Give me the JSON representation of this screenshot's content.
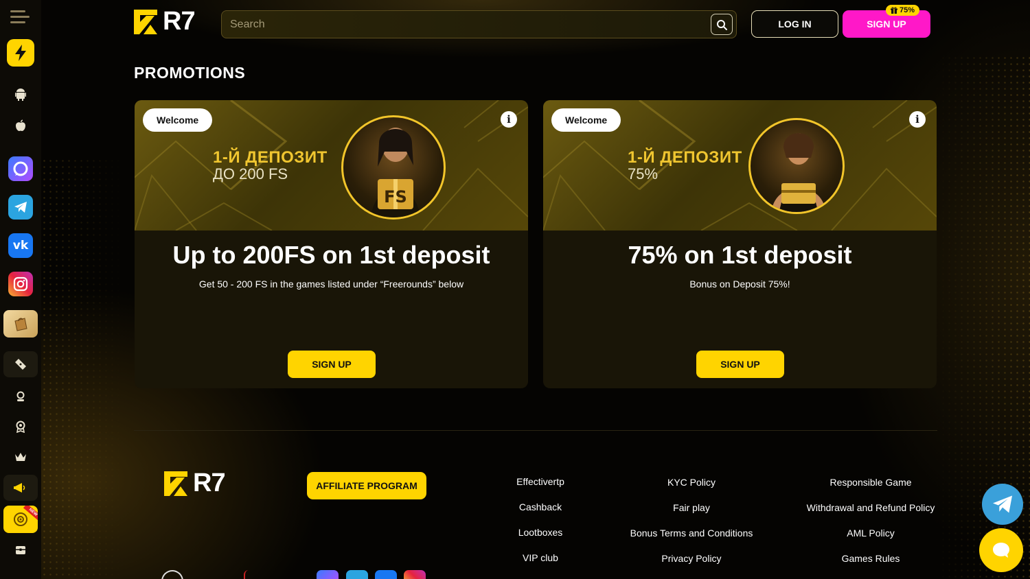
{
  "header": {
    "logo_text": "R7",
    "search_placeholder": "Search",
    "login_label": "LOG IN",
    "signup_label": "SIGN UP",
    "signup_badge": "75%"
  },
  "sidebar": {
    "items": [
      {
        "name": "menu-icon"
      },
      {
        "name": "lightning-icon",
        "glyph": "⚡"
      },
      {
        "name": "android-icon"
      },
      {
        "name": "apple-icon",
        "glyph": ""
      },
      {
        "name": "chat-app-icon"
      },
      {
        "name": "telegram-icon"
      },
      {
        "name": "vk-icon",
        "glyph": "vk"
      },
      {
        "name": "instagram-icon"
      },
      {
        "name": "shopping-bag-icon"
      },
      {
        "name": "ticket-icon"
      },
      {
        "name": "support-icon"
      },
      {
        "name": "award-icon"
      },
      {
        "name": "crown-icon"
      },
      {
        "name": "megaphone-icon"
      },
      {
        "name": "wheel-icon",
        "badge": "NEW"
      },
      {
        "name": "chest-icon"
      }
    ]
  },
  "page": {
    "title": "PROMOTIONS"
  },
  "promos": [
    {
      "tag": "Welcome",
      "banner_line1": "1-Й ДЕПОЗИТ",
      "banner_line2": "ДО 200 FS",
      "portrait_label": "FS",
      "heading": "Up to 200FS on 1st deposit",
      "description": "Get 50 - 200 FS in the games listed under “Freerounds” below",
      "button": "SIGN UP"
    },
    {
      "tag": "Welcome",
      "banner_line1": "1-Й ДЕПОЗИТ",
      "banner_line2": "75%",
      "heading": "75% on 1st deposit",
      "description": "Bonus on Deposit 75%!",
      "button": "SIGN UP"
    }
  ],
  "footer": {
    "logo_text": "R7",
    "affiliate_label": "AFFILIATE PROGRAM",
    "col1": [
      "Effectivertp",
      "Cashback",
      "Lootboxes",
      "VIP club"
    ],
    "col2": [
      "KYC Policy",
      "Fair play",
      "Bonus Terms and Conditions",
      "Privacy Policy"
    ],
    "col3": [
      "Responsible Game",
      "Withdrawal and Refund Policy",
      "AML Policy",
      "Games Rules"
    ]
  },
  "colors": {
    "accent_yellow": "#ffd400",
    "signup_pink": "#ff18c8",
    "telegram_blue": "#3aa0da",
    "background": "#050402"
  }
}
